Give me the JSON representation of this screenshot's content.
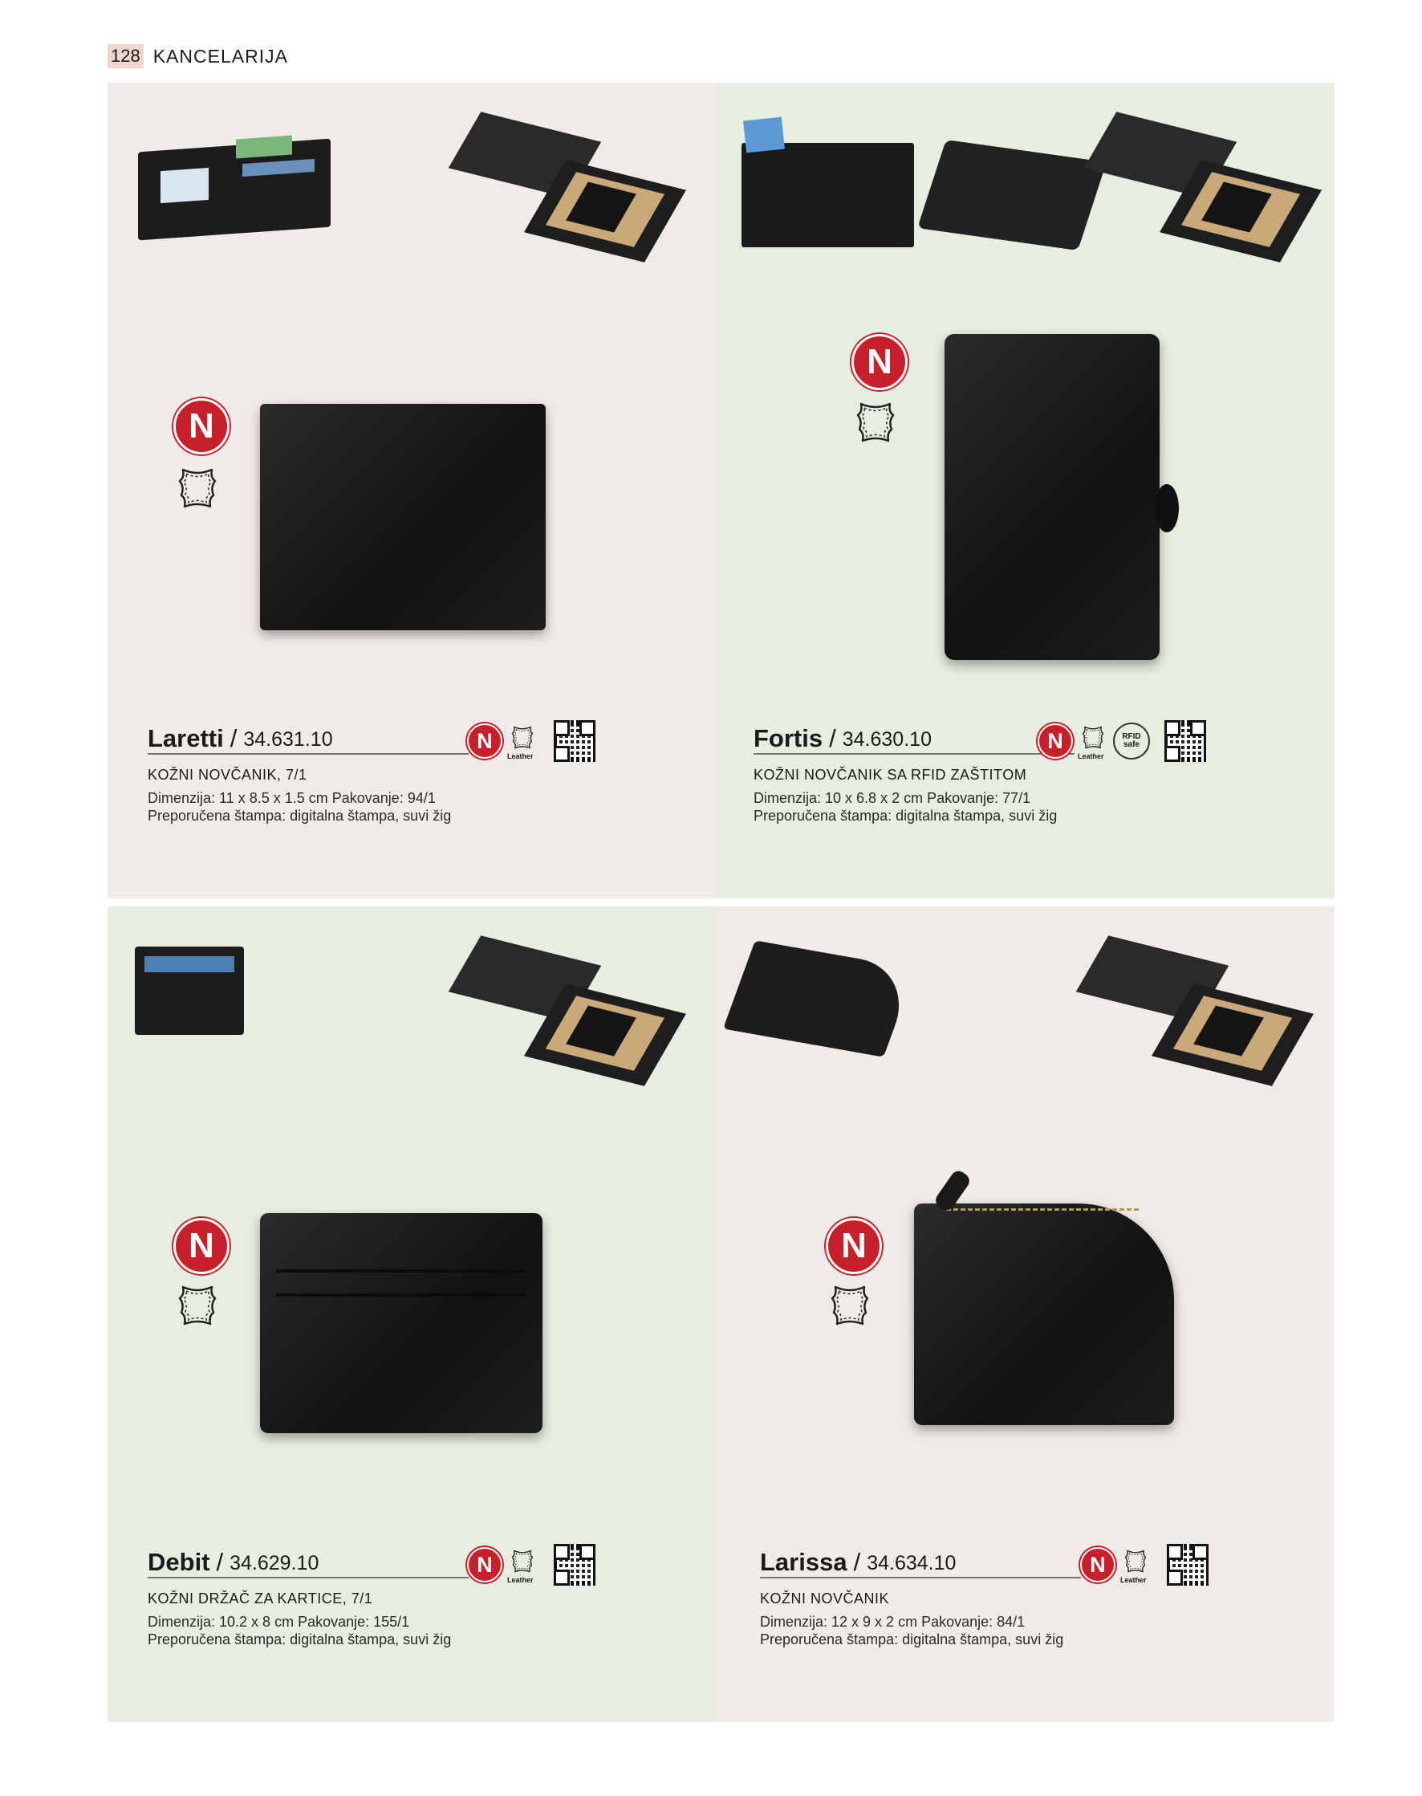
{
  "header": {
    "page_number": "128",
    "section": "KANCELARIJA"
  },
  "products": [
    {
      "name": "Laretti",
      "code": "34.631.10",
      "subtitle": "KOŽNI NOVČANIK, 7/1",
      "dimensions": "Dimenzija: 11 x 8.5 x 1.5 cm Pakovanje: 94/1",
      "print": "Preporučena štampa: digitalna štampa, suvi žig",
      "badge": "N",
      "leather_label": "Leather"
    },
    {
      "name": "Fortis",
      "code": "34.630.10",
      "subtitle": "KOŽNI NOVČANIK SA RFID ZAŠTITOM",
      "dimensions": "Dimenzija: 10 x 6.8 x 2 cm Pakovanje: 77/1",
      "print": "Preporučena štampa: digitalna štampa, suvi žig",
      "badge": "N",
      "leather_label": "Leather",
      "rfid_label": "RFID safe"
    },
    {
      "name": "Debit",
      "code": "34.629.10",
      "subtitle": "KOŽNI DRŽAČ ZA KARTICE, 7/1",
      "dimensions": "Dimenzija: 10.2 x 8 cm Pakovanje: 155/1",
      "print": "Preporučena štampa: digitalna štampa, suvi žig",
      "badge": "N",
      "leather_label": "Leather"
    },
    {
      "name": "Larissa",
      "code": "34.634.10",
      "subtitle": "KOŽNI NOVČANIK",
      "dimensions": "Dimenzija: 12 x 9 x 2 cm Pakovanje: 84/1",
      "print": "Preporučena štampa: digitalna štampa, suvi žig",
      "badge": "N",
      "leather_label": "Leather"
    }
  ],
  "slash": "/",
  "colors": {
    "badge_red": "#c8202a",
    "panel_pink": "#f1ebe7",
    "panel_green": "#e6eedf"
  }
}
